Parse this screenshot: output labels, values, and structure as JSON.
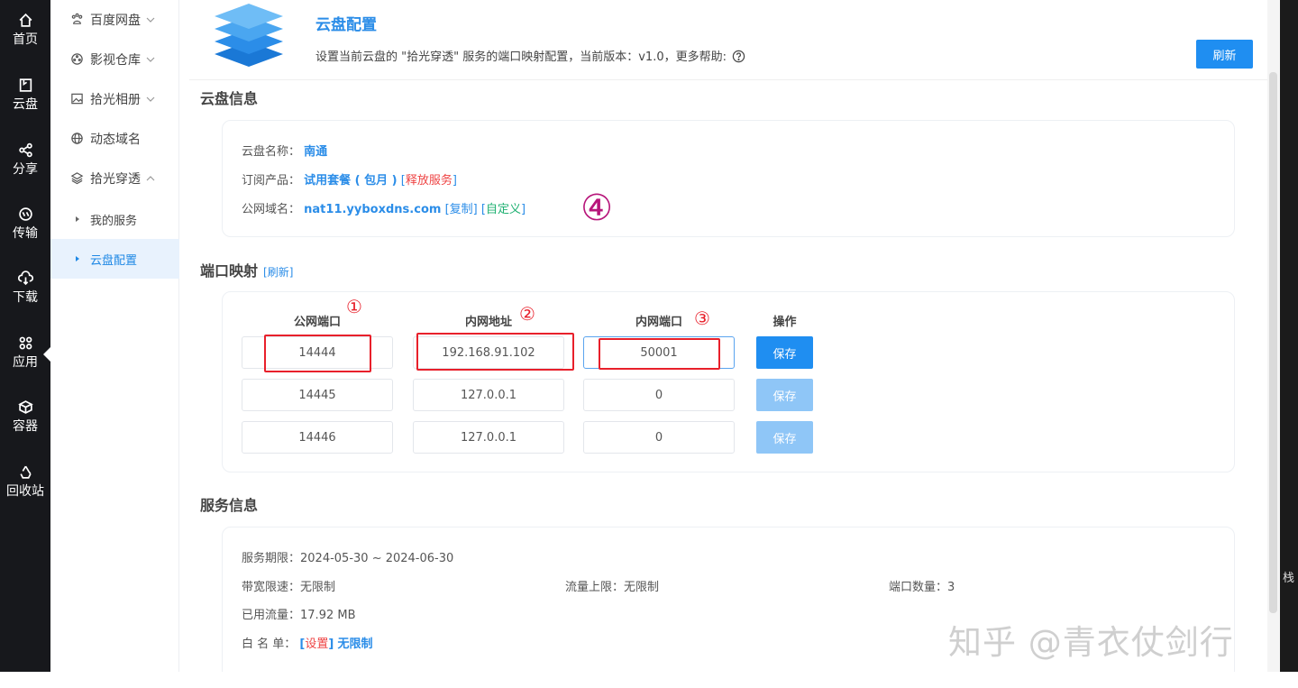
{
  "rail": {
    "items": [
      {
        "label": "首页",
        "icon": "home-icon"
      },
      {
        "label": "云盘",
        "icon": "cloud-disk-icon"
      },
      {
        "label": "分享",
        "icon": "share-icon"
      },
      {
        "label": "传输",
        "icon": "transfer-icon"
      },
      {
        "label": "下载",
        "icon": "download-icon"
      },
      {
        "label": "应用",
        "icon": "apps-icon"
      },
      {
        "label": "容器",
        "icon": "container-icon"
      },
      {
        "label": "回收站",
        "icon": "recycle-icon"
      }
    ],
    "active": "应用"
  },
  "sidebar": {
    "items": [
      {
        "label": "百度网盘",
        "icon": "baidu-paw-icon"
      },
      {
        "label": "影视仓库",
        "icon": "film-reel-icon"
      },
      {
        "label": "拾光相册",
        "icon": "photo-icon"
      },
      {
        "label": "动态域名",
        "icon": "globe-icon"
      },
      {
        "label": "拾光穿透",
        "icon": "layers-icon"
      }
    ],
    "children": [
      {
        "label": "我的服务"
      },
      {
        "label": "云盘配置"
      }
    ]
  },
  "header": {
    "title": "云盘配置",
    "description": "设置当前云盘的 \"拾光穿透\" 服务的端口映射配置，当前版本：v1.0，更多帮助:",
    "refresh_label": "刷新"
  },
  "disk_info": {
    "section_title": "云盘信息",
    "name_label": "云盘名称：",
    "name_value": "南通",
    "product_label": "订阅产品：",
    "product_value": "试用套餐 ( 包月 )",
    "release_link": "释放服务",
    "domain_label": "公网域名：",
    "domain_value": "nat11.yyboxdns.com",
    "copy_link": "复制",
    "custom_link": "自定义",
    "annotation_mark": "④"
  },
  "port_mapping": {
    "section_title": "端口映射",
    "refresh_link": "[刷新]",
    "columns": [
      "公网端口",
      "内网地址",
      "内网端口",
      "操作"
    ],
    "column_marks": [
      "①",
      "②",
      "③"
    ],
    "save_label": "保存",
    "rows": [
      {
        "public_port": "14444",
        "lan_addr": "192.168.91.102",
        "lan_port": "50001",
        "enabled": true
      },
      {
        "public_port": "14445",
        "lan_addr": "127.0.0.1",
        "lan_port": "0",
        "enabled": false
      },
      {
        "public_port": "14446",
        "lan_addr": "127.0.0.1",
        "lan_port": "0",
        "enabled": false
      }
    ],
    "highlight_color": "#e8202b"
  },
  "service_info": {
    "section_title": "服务信息",
    "period_label": "服务期限：",
    "period_value": "2024-05-30 ~ 2024-06-30",
    "bandwidth_label": "带宽限速：",
    "bandwidth_value": "无限制",
    "traffic_cap_label": "流量上限：",
    "traffic_cap_value": "无限制",
    "port_count_label": "端口数量：",
    "port_count_value": "3",
    "used_traffic_label": "已用流量：",
    "used_traffic_value": "17.92 MB",
    "whitelist_label": "白 名 单：",
    "whitelist_link": "设置",
    "whitelist_value": "无限制"
  },
  "watermark": "知乎 @青衣仗剑行",
  "right_edge_text": "栈",
  "colors": {
    "accent": "#1f8ef1",
    "link": "#2b8de8",
    "danger": "#ee4444",
    "success": "#1eb071",
    "rail_bg": "#17181c"
  }
}
